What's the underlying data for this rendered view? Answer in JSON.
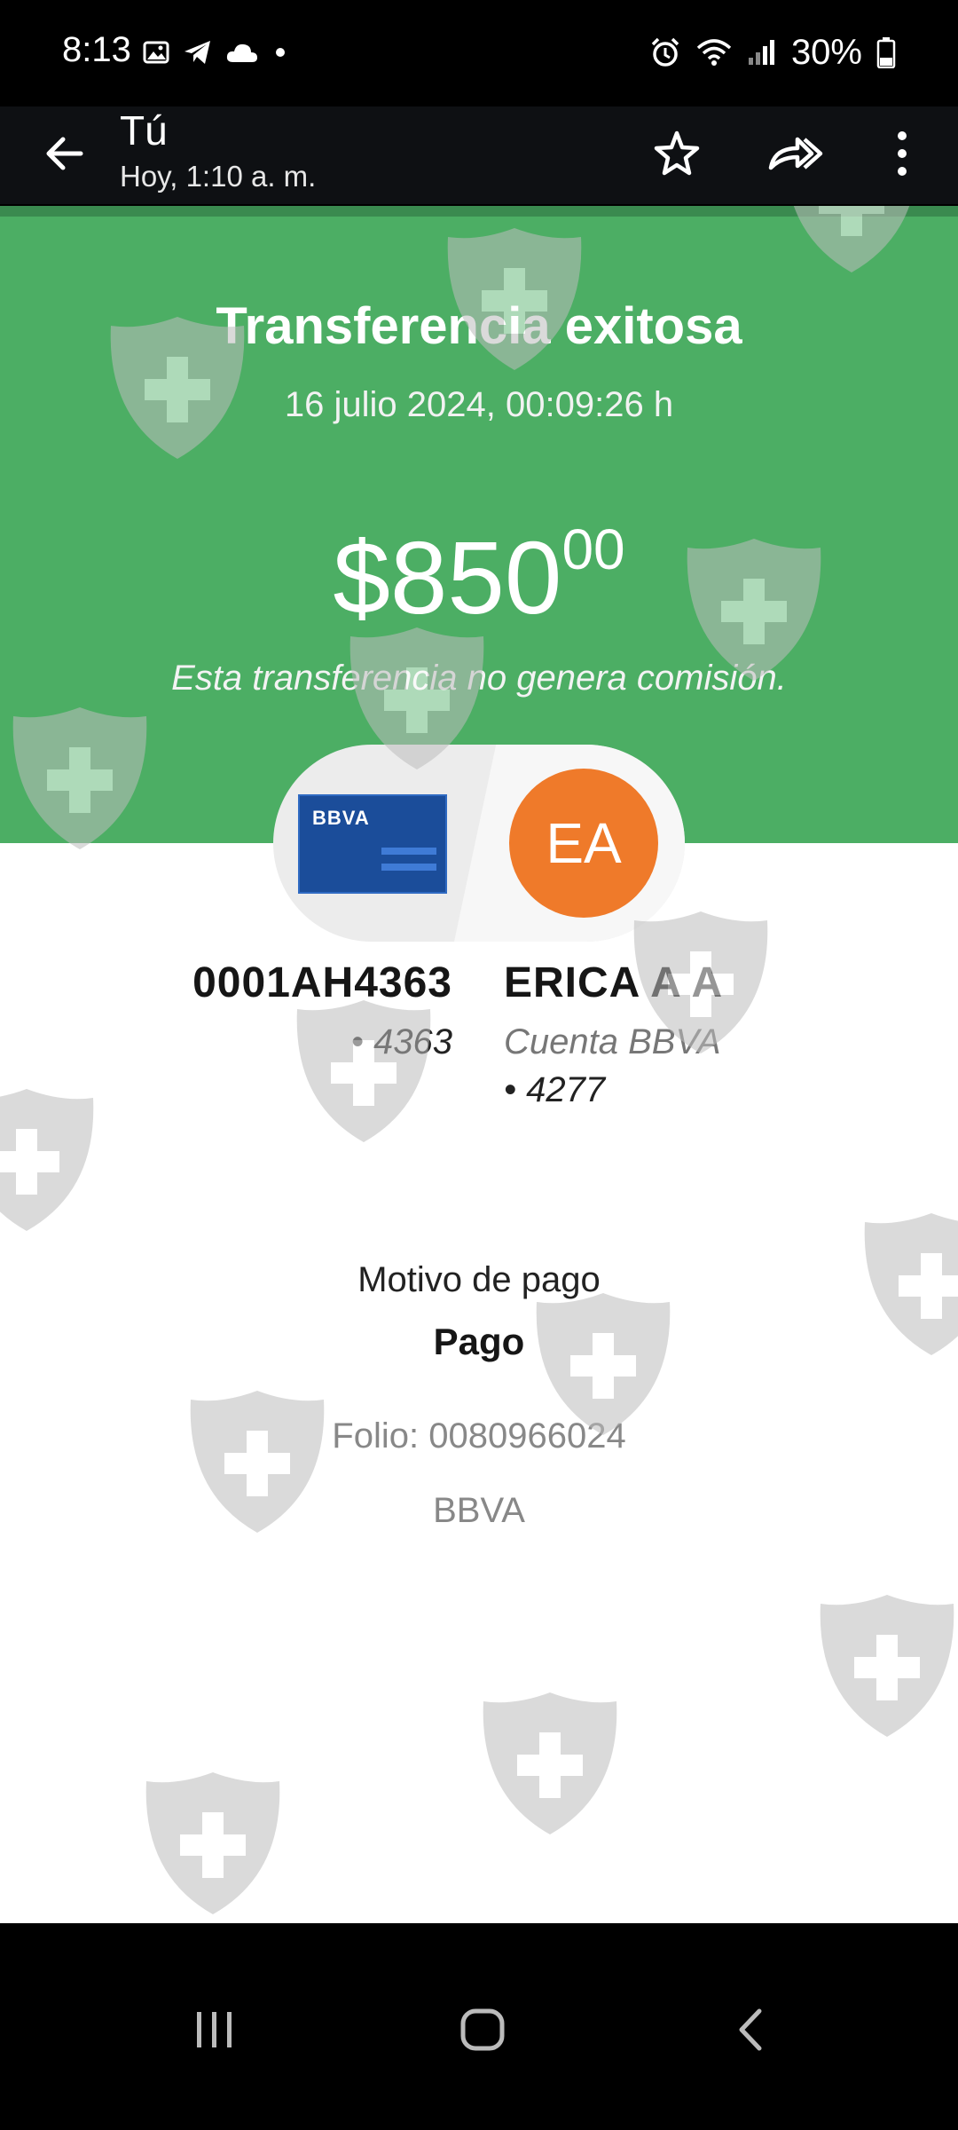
{
  "status_bar": {
    "time": "8:13",
    "battery": "30%",
    "left_icons": [
      "image-icon",
      "telegram-icon",
      "cloud-icon",
      "dot-icon"
    ],
    "right_icons": [
      "alarm-icon",
      "wifi-icon",
      "signal-icon",
      "battery-icon"
    ]
  },
  "app_bar": {
    "title": "Tú",
    "subtitle": "Hoy, 1:10 a. m."
  },
  "receipt": {
    "heading": "Transferencia exitosa",
    "datetime": "16 julio 2024, 00:09:26 h",
    "amount_main": "$850",
    "amount_cents": "00",
    "fee_note": "Esta transferencia no genera comisión.",
    "bank_logo": "BBVA",
    "avatar_initials": "EA",
    "from_account": "0001AH4363",
    "from_suffix": "• 4363",
    "to_name": "ERICA A A",
    "to_account_type": "Cuenta BBVA",
    "to_suffix": "• 4277",
    "reason_label": "Motivo de pago",
    "reason_value": "Pago",
    "folio": "Folio: 0080966024",
    "bank_name": "BBVA"
  },
  "colors": {
    "green": "#4cae64",
    "avatar_orange": "#ef7a2a",
    "card_blue": "#1b4d9a"
  }
}
